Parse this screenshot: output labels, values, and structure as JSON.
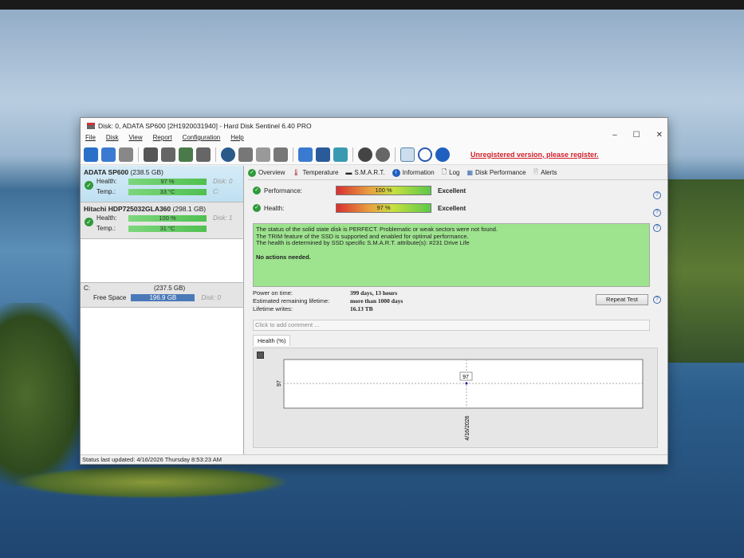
{
  "window": {
    "title": "Disk: 0, ADATA SP600 [2H1920031940]  -  Hard Disk Sentinel 6.40 PRO",
    "min": "–",
    "max": "☐",
    "close": "✕"
  },
  "menu": [
    "File",
    "Disk",
    "View",
    "Report",
    "Configuration",
    "Help"
  ],
  "unregistered": "Unregistered version, please register.",
  "disks": [
    {
      "name": "ADATA SP600",
      "size": "(238.5 GB)",
      "health_label": "Health:",
      "health": "97 %",
      "health_pct": 97,
      "disk": "Disk: 0",
      "temp_label": "Temp.:",
      "temp": "33 °C",
      "drive": "C:"
    },
    {
      "name": "Hitachi HDP725032GLA360",
      "size": "(298.1 GB)",
      "health_label": "Health:",
      "health": "100 %",
      "health_pct": 100,
      "disk": "Disk: 1",
      "temp_label": "Temp.:",
      "temp": "31 °C"
    }
  ],
  "partition": {
    "letter": "C:",
    "size": "(237.5 GB)",
    "free_label": "Free Space",
    "free": "196.9 GB",
    "disk": "Disk: 0"
  },
  "tabs": [
    "Overview",
    "Temperature",
    "S.M.A.R.T.",
    "Information",
    "Log",
    "Disk Performance",
    "Alerts"
  ],
  "performance": {
    "label": "Performance:",
    "value": "100 %",
    "pct": 100,
    "rating": "Excellent"
  },
  "health": {
    "label": "Health:",
    "value": "97 %",
    "pct": 97,
    "rating": "Excellent"
  },
  "status_lines": [
    "The status of the solid state disk is PERFECT. Problematic or weak sectors were not found.",
    "The TRIM feature of the SSD is supported and enabled for optimal performance.",
    "The health is determined by SSD specific S.M.A.R.T. attribute(s):  #231 Drive Life"
  ],
  "status_action": "No actions needed.",
  "info": {
    "power_label": "Power on time:",
    "power": "399 days, 13 hours",
    "remaining_label": "Estimated remaining lifetime:",
    "remaining": "more than 1000 days",
    "writes_label": "Lifetime writes:",
    "writes": "16.13 TB"
  },
  "repeat_test": "Repeat Test",
  "comment_placeholder": "Click to add comment ...",
  "health_tab": "Health (%)",
  "chart_data": {
    "type": "line",
    "title": "Health (%)",
    "x": [
      "4/16/2026"
    ],
    "values": [
      97
    ],
    "ylabel_tick": "97",
    "point_label": "97"
  },
  "statusbar": "Status last updated: 4/16/2026 Thursday 8:53:23 AM"
}
